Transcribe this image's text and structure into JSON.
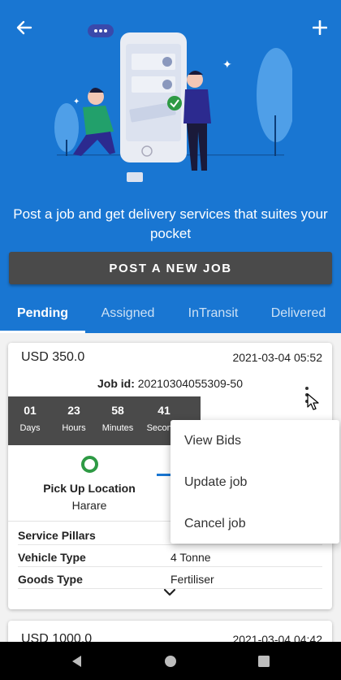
{
  "header": {
    "tagline": "Post a job and get delivery services that suites your pocket",
    "post_button": "POST A NEW JOB"
  },
  "tabs": [
    {
      "label": "Pending",
      "active": true
    },
    {
      "label": "Assigned",
      "active": false
    },
    {
      "label": "InTransit",
      "active": false
    },
    {
      "label": "Delivered",
      "active": false
    }
  ],
  "job": {
    "price": "USD 350.0",
    "datetime": "2021-03-04 05:52",
    "job_id_label": "Job id:",
    "job_id": "20210304055309-50",
    "countdown": [
      {
        "value": "01",
        "label": "Days"
      },
      {
        "value": "23",
        "label": "Hours"
      },
      {
        "value": "58",
        "label": "Minutes"
      },
      {
        "value": "41",
        "label": "Seconds"
      }
    ],
    "pickup_label": "Pick Up Location",
    "pickup_city": "Harare",
    "details": [
      {
        "key": "Service Pillars",
        "value": ""
      },
      {
        "key": "Vehicle Type",
        "value": "4 Tonne"
      },
      {
        "key": "Goods Type",
        "value": "Fertiliser"
      }
    ]
  },
  "menu": {
    "items": [
      "View Bids",
      "Update job",
      "Cancel job"
    ]
  },
  "job2": {
    "price": "USD 1000.0",
    "datetime": "2021-03-04 04:42"
  },
  "colors": {
    "primary": "#1976d2",
    "dark_button": "#4a4a4a",
    "pickup_green": "#2e9a44"
  },
  "icons": {
    "back": "arrow-left-icon",
    "add": "plus-icon",
    "more": "more-vertical-icon",
    "expand": "chevron-down-icon"
  }
}
